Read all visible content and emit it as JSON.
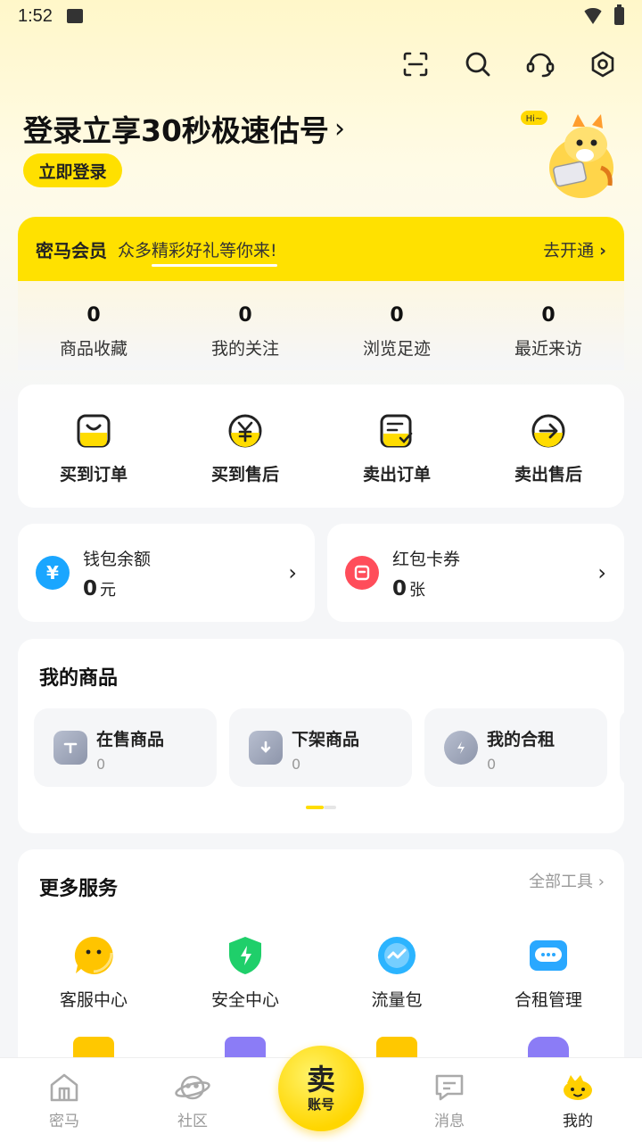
{
  "status": {
    "time": "1:52"
  },
  "header": {
    "icons": [
      "scan-icon",
      "search-icon",
      "headset-icon",
      "settings-icon"
    ],
    "login_title": "登录立享30秒极速估号",
    "login_chevron": "›",
    "login_button": "立即登录",
    "mascot_bubble": "Hi~"
  },
  "vip": {
    "title": "密马会员",
    "subtitle": "众多精彩好礼等你来!",
    "action": "去开通",
    "action_chevron": "›"
  },
  "stats": [
    {
      "value": "0",
      "label": "商品收藏"
    },
    {
      "value": "0",
      "label": "我的关注"
    },
    {
      "value": "0",
      "label": "浏览足迹"
    },
    {
      "value": "0",
      "label": "最近来访"
    }
  ],
  "orders": [
    {
      "label": "买到订单",
      "icon": "bag-icon"
    },
    {
      "label": "买到售后",
      "icon": "yuan-coin-icon"
    },
    {
      "label": "卖出订单",
      "icon": "order-check-icon"
    },
    {
      "label": "卖出售后",
      "icon": "arrow-circle-icon"
    }
  ],
  "wallet": {
    "balance_label": "钱包余额",
    "balance_value": "0",
    "balance_unit": "元",
    "balance_icon_glyph": "¥",
    "coupon_label": "红包卡券",
    "coupon_value": "0",
    "coupon_unit": "张",
    "chevron": "›"
  },
  "goods": {
    "title": "我的商品",
    "items": [
      {
        "name": "在售商品",
        "count": "0",
        "icon": "on-sale-icon"
      },
      {
        "name": "下架商品",
        "count": "0",
        "icon": "off-shelf-icon"
      },
      {
        "name": "我的合租",
        "count": "0",
        "icon": "shared-rent-icon"
      }
    ]
  },
  "services": {
    "title": "更多服务",
    "all_tools": "全部工具",
    "all_tools_chevron": "›",
    "items": [
      {
        "label": "客服中心",
        "icon": "customer-service-icon",
        "color": "#ffc400"
      },
      {
        "label": "安全中心",
        "icon": "security-shield-icon",
        "color": "#1fcf6a"
      },
      {
        "label": "流量包",
        "icon": "traffic-pack-icon",
        "color": "#2bb4ff"
      },
      {
        "label": "合租管理",
        "icon": "rent-manage-icon",
        "color": "#2aa8ff"
      }
    ],
    "row2_colors": [
      "#ffc800",
      "#8b7cf6",
      "#ffc800",
      "#8b7cf6"
    ]
  },
  "tabbar": {
    "tabs": [
      {
        "label": "密马",
        "icon": "home-icon"
      },
      {
        "label": "社区",
        "icon": "planet-icon"
      },
      {
        "label": "消息",
        "icon": "message-icon"
      },
      {
        "label": "我的",
        "icon": "profile-mascot-icon"
      }
    ],
    "sell_big": "卖",
    "sell_small": "账号"
  },
  "colors": {
    "accent": "#ffe100",
    "background": "#f5f6f8"
  }
}
